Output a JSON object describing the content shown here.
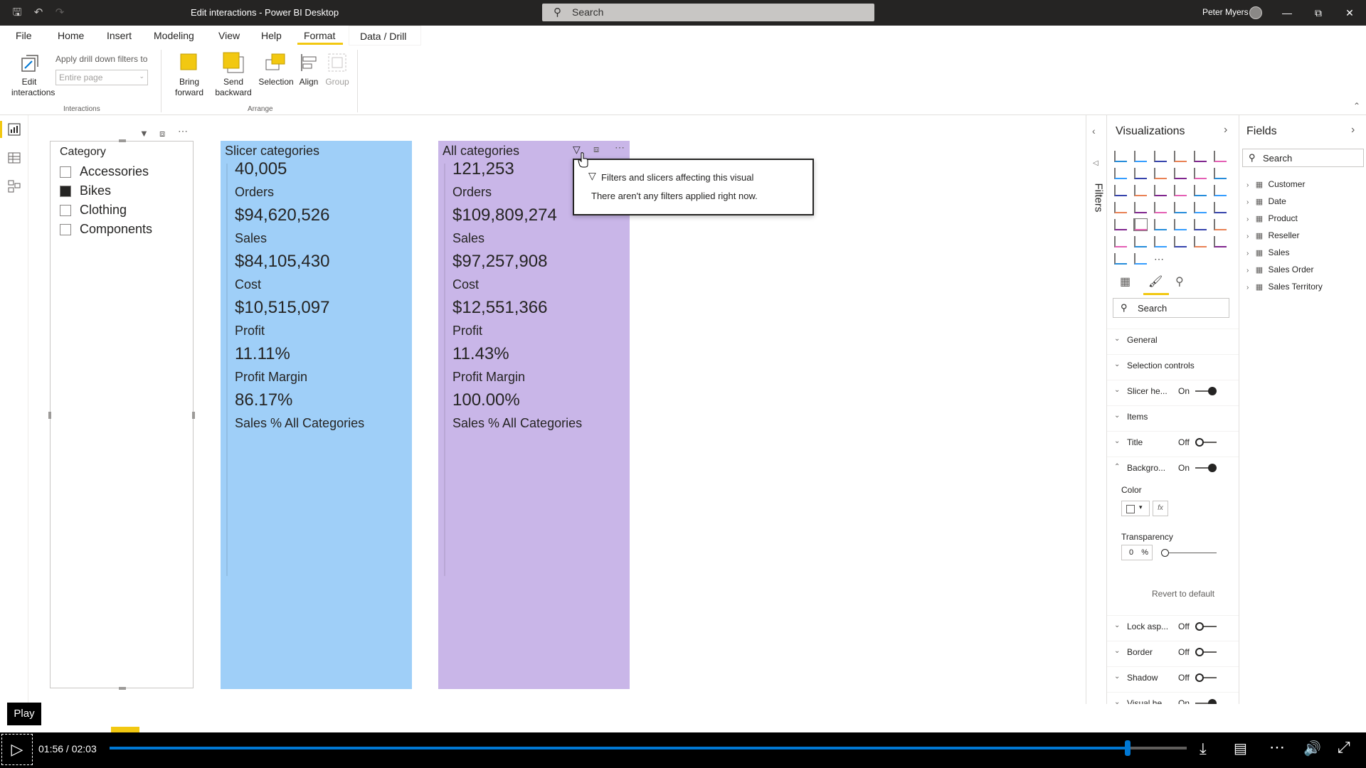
{
  "window": {
    "title": "Edit interactions - Power BI Desktop",
    "search_placeholder": "Search",
    "user": "Peter Myers"
  },
  "tabs": [
    "File",
    "Home",
    "Insert",
    "Modeling",
    "View",
    "Help",
    "Format",
    "Data / Drill"
  ],
  "active_tab": "Format",
  "ribbon": {
    "edit_interactions": "Edit interactions",
    "apply_drill_label": "Apply drill down filters to",
    "apply_drill_value": "Entire page",
    "interactions_group": "Interactions",
    "bring_forward": "Bring forward",
    "send_backward": "Send backward",
    "selection": "Selection",
    "align": "Align",
    "group": "Group",
    "arrange_group": "Arrange"
  },
  "slicer": {
    "header": "Category",
    "items": [
      {
        "label": "Accessories",
        "checked": false
      },
      {
        "label": "Bikes",
        "checked": true
      },
      {
        "label": "Clothing",
        "checked": false
      },
      {
        "label": "Components",
        "checked": false
      }
    ]
  },
  "cards": [
    {
      "title": "Slicer categories",
      "color": "#9fcff8",
      "metrics": [
        {
          "value": "40,005",
          "label": "Orders"
        },
        {
          "value": "$94,620,526",
          "label": "Sales"
        },
        {
          "value": "$84,105,430",
          "label": "Cost"
        },
        {
          "value": "$10,515,097",
          "label": "Profit"
        },
        {
          "value": "11.11%",
          "label": "Profit Margin"
        },
        {
          "value": "86.17%",
          "label": "Sales % All Categories"
        }
      ]
    },
    {
      "title": "All categories",
      "color": "#c9b6e8",
      "metrics": [
        {
          "value": "121,253",
          "label": "Orders"
        },
        {
          "value": "$109,809,274",
          "label": "Sales"
        },
        {
          "value": "$97,257,908",
          "label": "Cost"
        },
        {
          "value": "$12,551,366",
          "label": "Profit"
        },
        {
          "value": "11.43%",
          "label": "Profit Margin"
        },
        {
          "value": "100.00%",
          "label": "Sales % All Categories"
        }
      ]
    }
  ],
  "tooltip": {
    "line1": "Filters and slicers affecting this visual",
    "line2": "There aren't any filters applied right now."
  },
  "filters_label": "Filters",
  "visualizations": {
    "title": "Visualizations",
    "search_placeholder": "Search",
    "sections": [
      {
        "name": "General",
        "state": "",
        "toggle": ""
      },
      {
        "name": "Selection controls",
        "state": "",
        "toggle": ""
      },
      {
        "name": "Slicer he...",
        "state": "On",
        "toggle": "on"
      },
      {
        "name": "Items",
        "state": "",
        "toggle": ""
      },
      {
        "name": "Title",
        "state": "Off",
        "toggle": "off"
      },
      {
        "name": "Backgro...",
        "state": "On",
        "toggle": "on"
      }
    ],
    "color_label": "Color",
    "fx_label": "fx",
    "transparency_label": "Transparency",
    "transparency_value": "0",
    "transparency_unit": "%",
    "revert": "Revert to default",
    "sections_after": [
      {
        "name": "Lock asp...",
        "state": "Off",
        "toggle": "off"
      },
      {
        "name": "Border",
        "state": "Off",
        "toggle": "off"
      },
      {
        "name": "Shadow",
        "state": "Off",
        "toggle": "off"
      },
      {
        "name": "Visual he...",
        "state": "On",
        "toggle": "on"
      }
    ]
  },
  "fields": {
    "title": "Fields",
    "search_placeholder": "Search",
    "tables": [
      "Customer",
      "Date",
      "Product",
      "Reseller",
      "Sales",
      "Sales Order",
      "Sales Territory"
    ]
  },
  "player": {
    "play_label": "Play",
    "time": "01:56 / 02:03",
    "progress": 0.945
  },
  "colors": {
    "accent": "#f2c811",
    "titlebar": "#252423",
    "player_bar": "#0078d4"
  }
}
